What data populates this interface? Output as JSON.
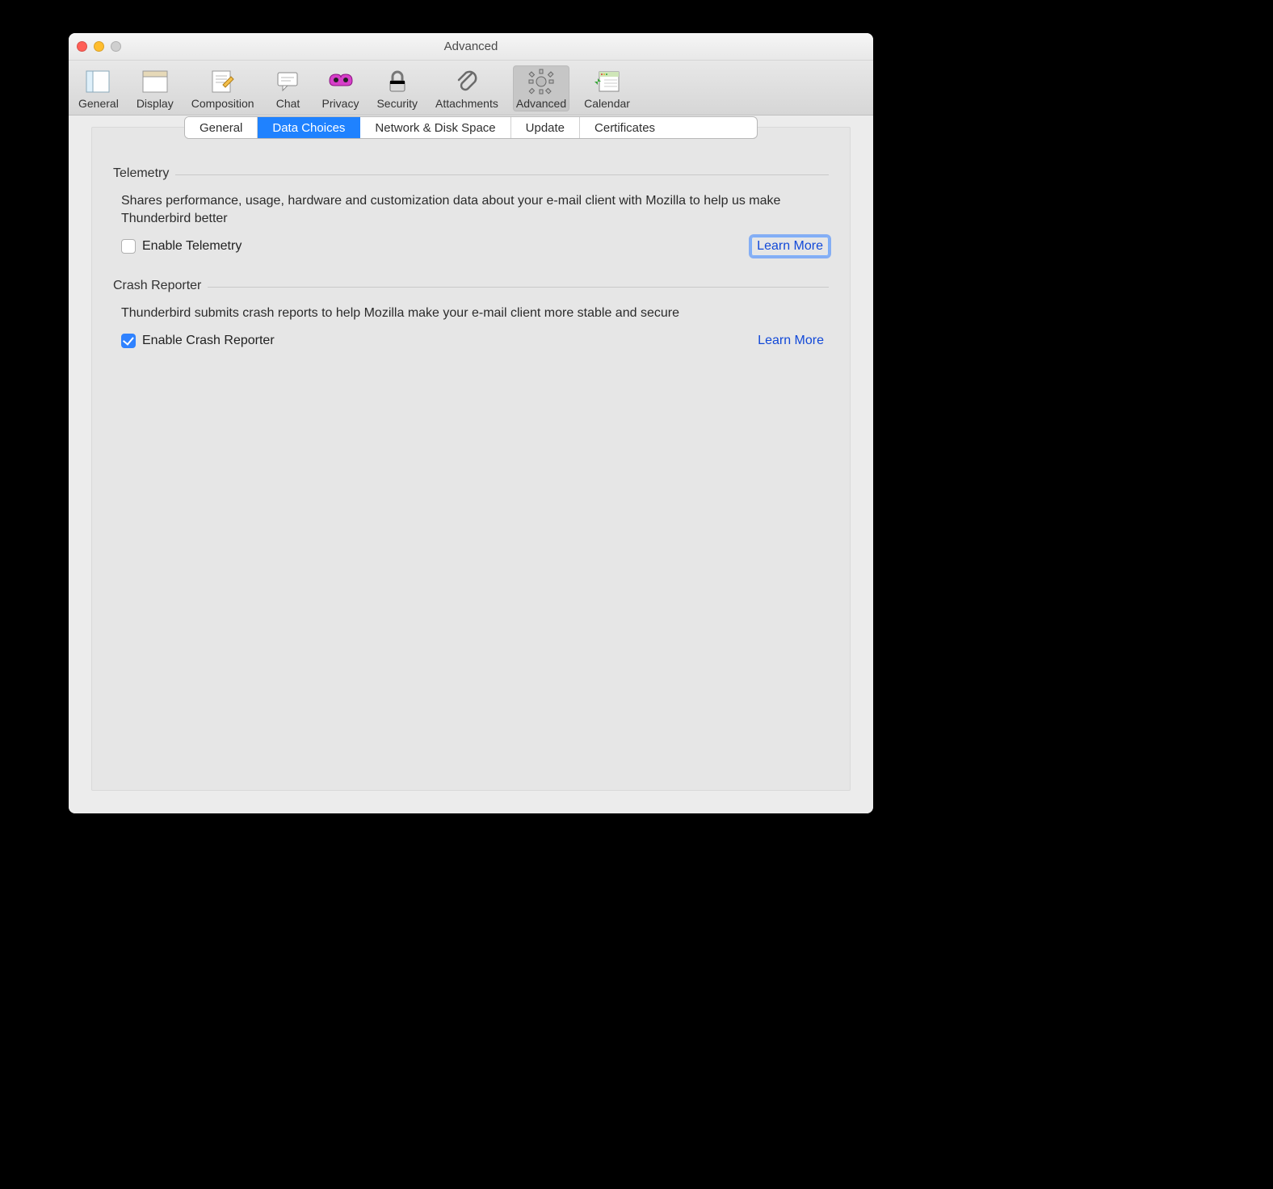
{
  "window": {
    "title": "Advanced"
  },
  "toolbar": {
    "items": [
      {
        "label": "General",
        "icon": "general-icon"
      },
      {
        "label": "Display",
        "icon": "display-icon"
      },
      {
        "label": "Composition",
        "icon": "composition-icon"
      },
      {
        "label": "Chat",
        "icon": "chat-icon"
      },
      {
        "label": "Privacy",
        "icon": "privacy-icon"
      },
      {
        "label": "Security",
        "icon": "security-icon"
      },
      {
        "label": "Attachments",
        "icon": "attachments-icon"
      },
      {
        "label": "Advanced",
        "icon": "advanced-icon",
        "selected": true
      },
      {
        "label": "Calendar",
        "icon": "calendar-icon"
      }
    ]
  },
  "tabs": {
    "items": [
      {
        "label": "General"
      },
      {
        "label": "Data Choices",
        "active": true
      },
      {
        "label": "Network & Disk Space"
      },
      {
        "label": "Update"
      },
      {
        "label": "Certificates"
      }
    ]
  },
  "sections": {
    "telemetry": {
      "title": "Telemetry",
      "desc": "Shares performance, usage, hardware and customization data about your e-mail client with Mozilla to help us make Thunderbird better",
      "checkbox_label": "Enable Telemetry",
      "checked": false,
      "link": "Learn More",
      "link_focused": true
    },
    "crash": {
      "title": "Crash Reporter",
      "desc": "Thunderbird submits crash reports to help Mozilla make your e-mail client more stable and secure",
      "checkbox_label": "Enable Crash Reporter",
      "checked": true,
      "link": "Learn More",
      "link_focused": false
    }
  }
}
